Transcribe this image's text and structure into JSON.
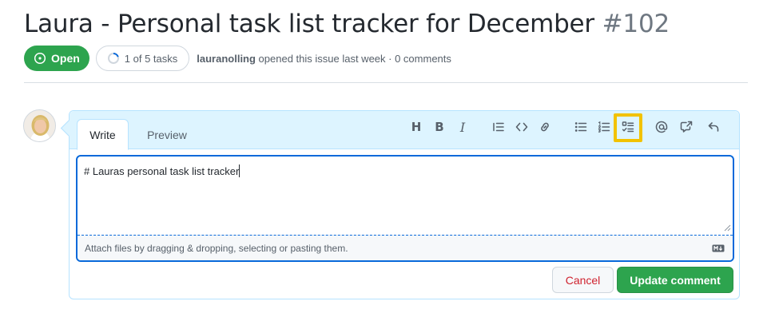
{
  "issue": {
    "title": "Laura - Personal task list tracker for December",
    "number": "#102",
    "status_label": "Open",
    "tasks_progress_label": "1 of 5 tasks",
    "tasks_done": 1,
    "tasks_total": 5,
    "author": "lauranolling",
    "opened_text": " opened this issue last week · 0 comments"
  },
  "editor": {
    "tabs": [
      {
        "label": "Write",
        "active": true
      },
      {
        "label": "Preview",
        "active": false
      }
    ],
    "toolbar": [
      {
        "name": "heading",
        "glyph": "H"
      },
      {
        "name": "bold",
        "glyph": "B"
      },
      {
        "name": "italic",
        "glyph": "I"
      },
      {
        "name": "quote",
        "icon": "quote-icon"
      },
      {
        "name": "code",
        "icon": "code-icon"
      },
      {
        "name": "link",
        "icon": "link-icon"
      },
      {
        "name": "unordered-list",
        "icon": "list-unordered-icon"
      },
      {
        "name": "ordered-list",
        "icon": "list-ordered-icon"
      },
      {
        "name": "task-list",
        "icon": "tasklist-icon",
        "highlighted": true
      },
      {
        "name": "mention",
        "icon": "mention-icon"
      },
      {
        "name": "reference",
        "icon": "cross-reference-icon"
      },
      {
        "name": "reply",
        "icon": "reply-icon"
      }
    ],
    "textarea_value": "# Lauras personal task list tracker",
    "attach_hint": "Attach files by dragging & dropping, selecting or pasting them.",
    "markdown_icon": "markdown-icon"
  },
  "actions": {
    "cancel_label": "Cancel",
    "update_label": "Update comment"
  },
  "colors": {
    "open_green": "#2da44e",
    "cancel_red": "#cf222e",
    "focus_blue": "#0969da",
    "highlight_yellow": "#f2c200",
    "header_tint": "#ddf4ff"
  }
}
